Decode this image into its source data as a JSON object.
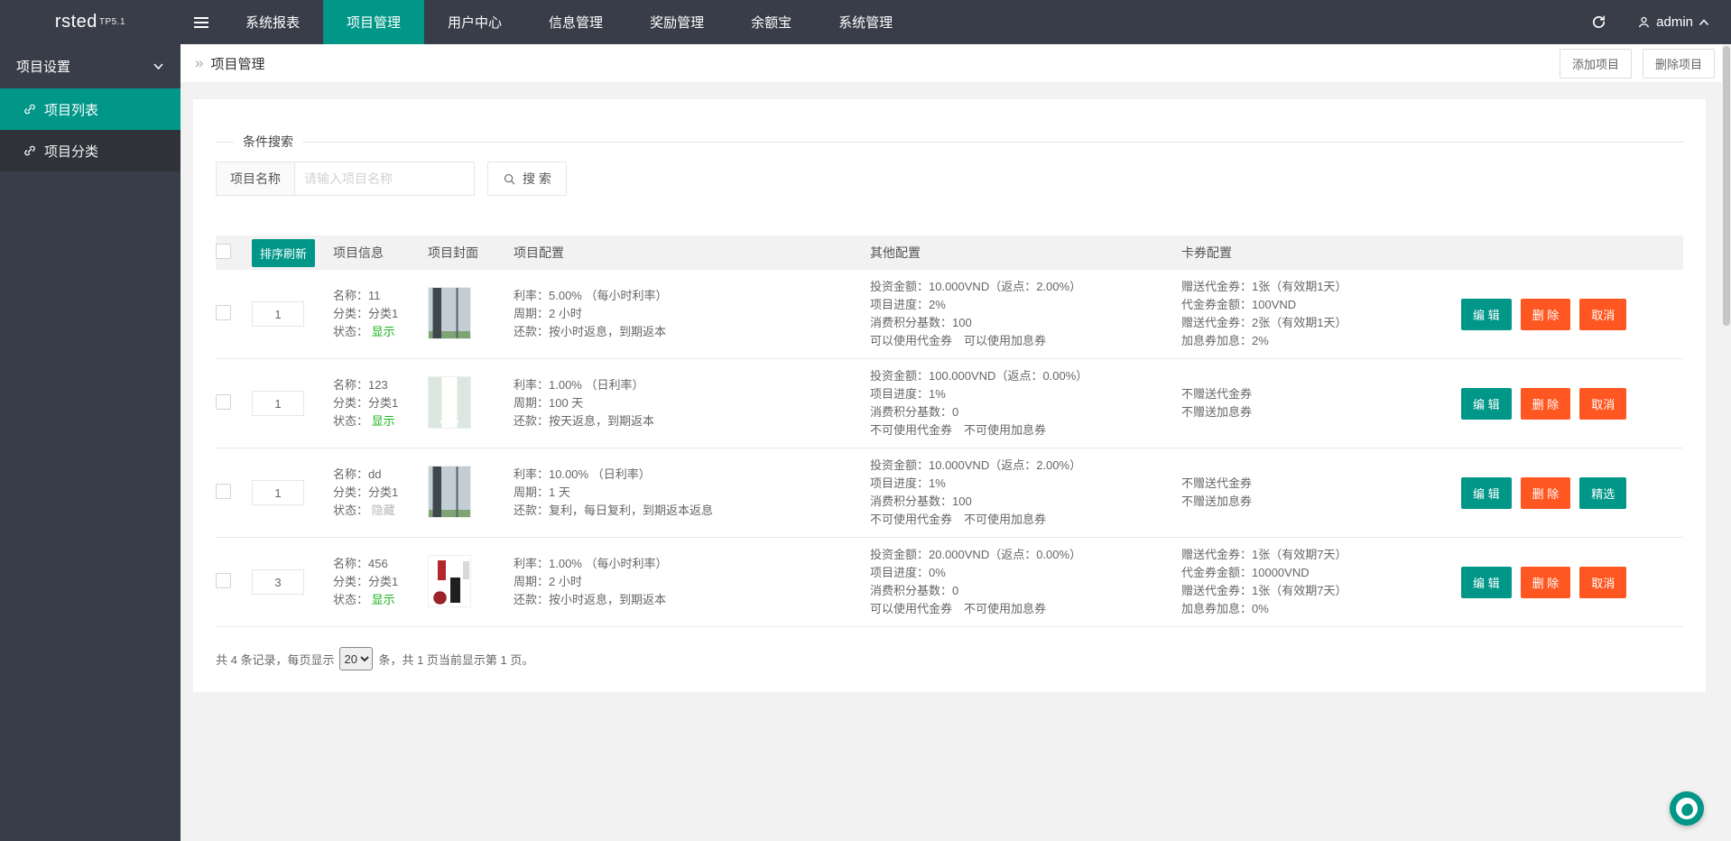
{
  "colors": {
    "accent_teal": "#009688",
    "accent_orange": "#FF5722",
    "status_show_green": "#17b317",
    "navbar_dark": "#393D49"
  },
  "navbar": {
    "logo": "rsted",
    "logo_version": "TP5.1",
    "items": [
      {
        "label": "系统报表",
        "active": false
      },
      {
        "label": "项目管理",
        "active": true
      },
      {
        "label": "用户中心",
        "active": false
      },
      {
        "label": "信息管理",
        "active": false
      },
      {
        "label": "奖励管理",
        "active": false
      },
      {
        "label": "余额宝",
        "active": false
      },
      {
        "label": "系统管理",
        "active": false
      }
    ],
    "user": "admin"
  },
  "sidebar": {
    "group_label": "项目设置",
    "items": [
      {
        "label": "项目列表",
        "active": true
      },
      {
        "label": "项目分类",
        "active": false
      }
    ]
  },
  "breadcrumb": {
    "separator": "»",
    "title": "项目管理"
  },
  "header_actions": {
    "add": "添加项目",
    "delete": "删除项目"
  },
  "search": {
    "legend": "条件搜索",
    "label": "项目名称",
    "placeholder": "请输入项目名称",
    "button": "搜 索"
  },
  "table": {
    "sort_refresh": "排序刷新",
    "headers": {
      "info": "项目信息",
      "cover": "项目封面",
      "config": "项目配置",
      "other": "其他配置",
      "cards": "卡券配置"
    },
    "rows": [
      {
        "sort": "1",
        "info": {
          "name": "名称：11",
          "category": "分类：分类1",
          "status_label": "状态：",
          "status": "显示",
          "status_color": "green"
        },
        "cover": "building",
        "config": [
          "利率：5.00% （每小时利率）",
          "周期：2 小时",
          "还款：按小时返息，到期返本"
        ],
        "other": [
          "投资金额：10.000VND（返点：2.00%）",
          "项目进度：2%",
          "消费积分基数：100",
          "可以使用代金券　可以使用加息券"
        ],
        "cards": [
          "赠送代金券：1张（有效期1天）",
          "代金券金额：100VND",
          "赠送代金券：2张（有效期1天）",
          "加息券加息：2%"
        ],
        "actions": [
          {
            "label": "编 辑",
            "type": "teal"
          },
          {
            "label": "删 除",
            "type": "orange"
          },
          {
            "label": "取消",
            "type": "orange"
          }
        ]
      },
      {
        "sort": "1",
        "info": {
          "name": "名称：123",
          "category": "分类：分类1",
          "status_label": "状态：",
          "status": "显示",
          "status_color": "green"
        },
        "cover": "humidifier",
        "config": [
          "利率：1.00% （日利率）",
          "周期：100 天",
          "还款：按天返息，到期返本"
        ],
        "other": [
          "投资金额：100.000VND（返点：0.00%）",
          "项目进度：1%",
          "消费积分基数：0",
          "不可使用代金券　不可使用加息券"
        ],
        "cards": [
          "不赠送代金券",
          "不赠送加息券"
        ],
        "actions": [
          {
            "label": "编 辑",
            "type": "teal"
          },
          {
            "label": "删 除",
            "type": "orange"
          },
          {
            "label": "取消",
            "type": "orange"
          }
        ]
      },
      {
        "sort": "1",
        "info": {
          "name": "名称：dd",
          "category": "分类：分类1",
          "status_label": "状态：",
          "status": "隐藏",
          "status_color": "gray"
        },
        "cover": "building",
        "config": [
          "利率：10.00% （日利率）",
          "周期：1 天",
          "还款：复利，每日复利，到期返本返息"
        ],
        "other": [
          "投资金额：10.000VND（返点：2.00%）",
          "项目进度：1%",
          "消费积分基数：100",
          "不可使用代金券　不可使用加息券"
        ],
        "cards": [
          "不赠送代金券",
          "不赠送加息券"
        ],
        "actions": [
          {
            "label": "编 辑",
            "type": "teal"
          },
          {
            "label": "删 除",
            "type": "orange"
          },
          {
            "label": "精选",
            "type": "teal"
          }
        ]
      },
      {
        "sort": "3",
        "info": {
          "name": "名称：456",
          "category": "分类：分类1",
          "status_label": "状态：",
          "status": "显示",
          "status_color": "green"
        },
        "cover": "products",
        "config": [
          "利率：1.00% （每小时利率）",
          "周期：2 小时",
          "还款：按小时返息，到期返本"
        ],
        "other": [
          "投资金额：20.000VND（返点：0.00%）",
          "项目进度：0%",
          "消费积分基数：0",
          "可以使用代金券　不可使用加息券"
        ],
        "cards": [
          "赠送代金券：1张（有效期7天）",
          "代金券金额：10000VND",
          "赠送代金券：1张（有效期7天）",
          "加息券加息：0%"
        ],
        "actions": [
          {
            "label": "编 辑",
            "type": "teal"
          },
          {
            "label": "删 除",
            "type": "orange"
          },
          {
            "label": "取消",
            "type": "orange"
          }
        ]
      }
    ]
  },
  "pagination": {
    "prefix": "共 4 条记录，每页显示",
    "page_size": "20",
    "suffix": "条，共 1 页当前显示第 1 页。"
  }
}
